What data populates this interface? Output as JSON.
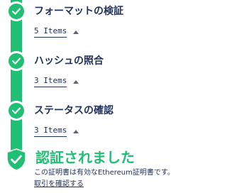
{
  "colors": {
    "accent": "#21bf73",
    "text": "#21325b",
    "caret": "#5a6478"
  },
  "steps": [
    {
      "title": "フォーマットの検証",
      "items_label": "5 Items",
      "icon": "check-icon",
      "caret_icon": "caret-up-icon"
    },
    {
      "title": "ハッシュの照合",
      "items_label": "3 Items",
      "icon": "check-icon",
      "caret_icon": "caret-up-icon"
    },
    {
      "title": "ステータスの確認",
      "items_label": "3 Items",
      "icon": "check-icon",
      "caret_icon": "caret-up-icon"
    }
  ],
  "result": {
    "icon": "shield-check-icon",
    "title": "認証されました",
    "description": "この証明書は有効なEthereum証明書です。",
    "link_label": "取引を確認する"
  }
}
